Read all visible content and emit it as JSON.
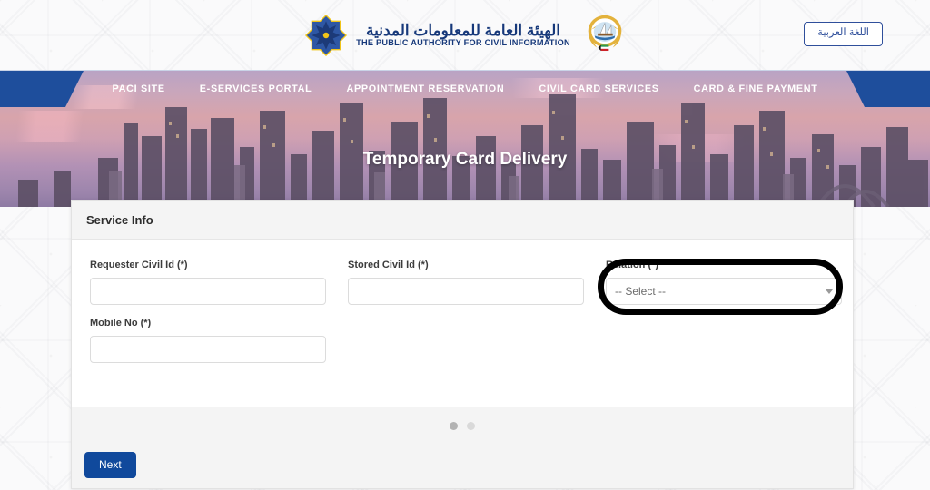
{
  "header": {
    "logo_ar": "الهيئة العامة للمعلومات المدنية",
    "logo_en": "THE PUBLIC AUTHORITY FOR CIVIL INFORMATION",
    "paci_star_icon": "paci-star-emblem-icon",
    "kuwait_emblem_icon": "kuwait-state-emblem-icon",
    "language_button": "اللغة العربية"
  },
  "nav": {
    "items": [
      {
        "label": "PACI SITE"
      },
      {
        "label": "E-SERVICES PORTAL"
      },
      {
        "label": "APPOINTMENT RESERVATION"
      },
      {
        "label": "CIVIL CARD SERVICES"
      },
      {
        "label": "CARD & FINE PAYMENT"
      }
    ]
  },
  "banner": {
    "title": "Temporary Card Delivery"
  },
  "card": {
    "header_title": "Service Info",
    "fields": {
      "requester_civil_id": {
        "label": "Requester Civil Id (*)",
        "value": "",
        "placeholder": ""
      },
      "stored_civil_id": {
        "label": "Stored Civil Id (*)",
        "value": "",
        "placeholder": ""
      },
      "relation": {
        "label": "Relation (*)",
        "value": "-- Select --"
      },
      "mobile_no": {
        "label": "Mobile No (*)",
        "value": "",
        "placeholder": ""
      }
    },
    "footer": {
      "next_label": "Next",
      "steps_total": 2,
      "step_active": 1
    }
  },
  "colors": {
    "nav_blue": "#1e4e9c",
    "button_blue": "#10499c",
    "brand_navy": "#16387a",
    "annotation": "#000000"
  }
}
